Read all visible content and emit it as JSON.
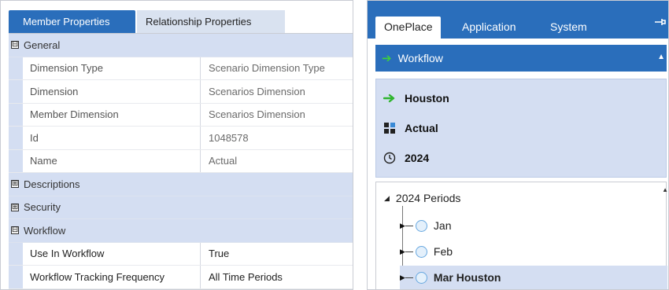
{
  "left_panel": {
    "tabs": [
      {
        "label": "Member Properties",
        "active": true
      },
      {
        "label": "Relationship Properties",
        "active": false
      }
    ],
    "rows": [
      {
        "type": "category",
        "expander": "⊟",
        "label": "General",
        "value": ""
      },
      {
        "type": "property",
        "label": "Dimension Type",
        "value": "Scenario Dimension Type"
      },
      {
        "type": "property",
        "label": "Dimension",
        "value": "Scenarios Dimension"
      },
      {
        "type": "property",
        "label": "Member Dimension",
        "value": "Scenarios Dimension"
      },
      {
        "type": "property",
        "label": "Id",
        "value": "1048578"
      },
      {
        "type": "property",
        "label": "Name",
        "value": "Actual"
      },
      {
        "type": "category",
        "expander": "⊞",
        "label": "Descriptions",
        "value": ""
      },
      {
        "type": "category",
        "expander": "⊞",
        "label": "Security",
        "value": ""
      },
      {
        "type": "category",
        "expander": "⊟",
        "label": "Workflow",
        "value": ""
      },
      {
        "type": "property",
        "dark": true,
        "label": "Use In Workflow",
        "value": "True"
      },
      {
        "type": "property",
        "dark": true,
        "label": "Workflow Tracking Frequency",
        "value": "All Time Periods"
      }
    ]
  },
  "right_panel": {
    "tabs": [
      "OnePlace",
      "Application",
      "System"
    ],
    "active_tab": "OnePlace",
    "pin_icon": "pin-icon",
    "workflow_bar": {
      "label": "Workflow",
      "collapse_icon": "caret-up-icon"
    },
    "pov": {
      "workflow": "Houston",
      "scenario": "Actual",
      "time": "2024"
    },
    "tree": {
      "root": "2024 Periods",
      "items": [
        {
          "label": "Jan",
          "selected": false
        },
        {
          "label": "Feb",
          "selected": false
        },
        {
          "label": "Mar Houston",
          "selected": true
        }
      ]
    },
    "colors": {
      "accent": "#2a6ebb",
      "panel_bg": "#d4def2",
      "green_arrow": "#3dcf3d",
      "circle": "#68a8e0"
    }
  }
}
